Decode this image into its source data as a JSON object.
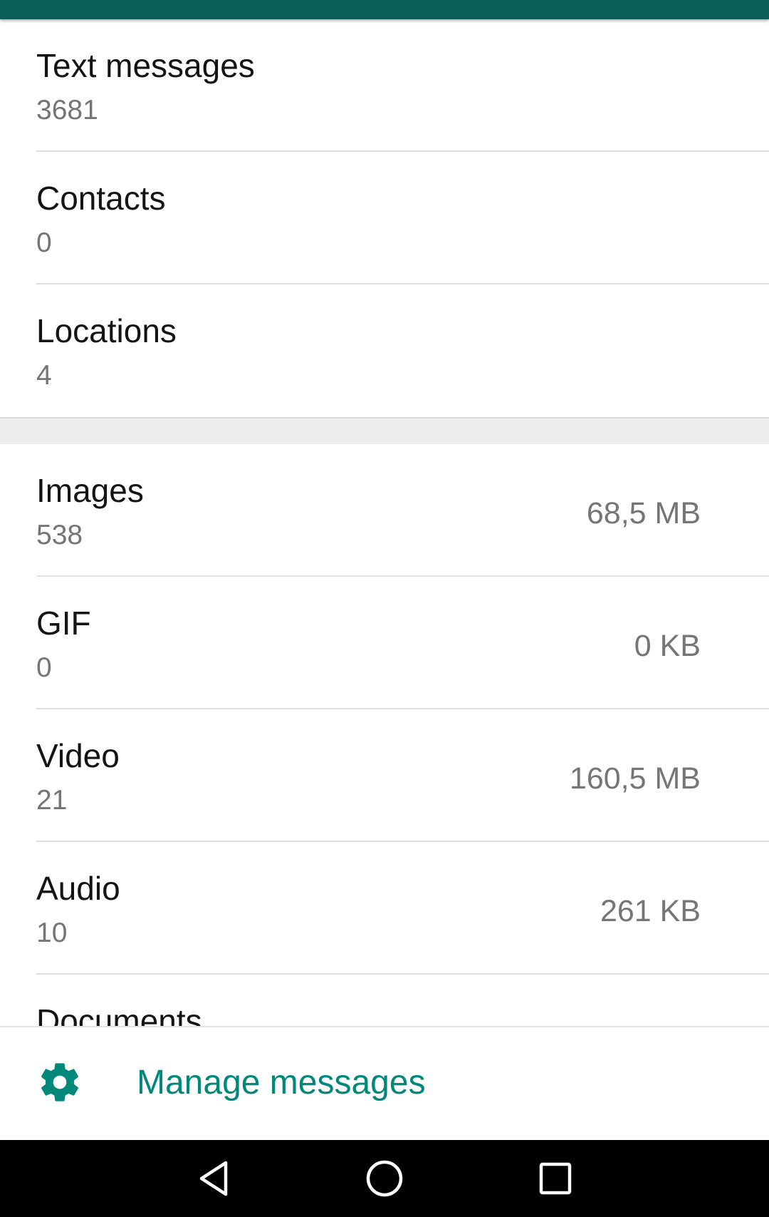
{
  "theme": {
    "appbar_color": "#0b5e55",
    "accent": "#00897b"
  },
  "messages_section": {
    "items": [
      {
        "label": "Text messages",
        "count": "3681"
      },
      {
        "label": "Contacts",
        "count": "0"
      },
      {
        "label": "Locations",
        "count": "4"
      }
    ]
  },
  "media_section": {
    "items": [
      {
        "label": "Images",
        "count": "538",
        "size": "68,5 MB"
      },
      {
        "label": "GIF",
        "count": "0",
        "size": "0 KB"
      },
      {
        "label": "Video",
        "count": "21",
        "size": "160,5 MB"
      },
      {
        "label": "Audio",
        "count": "10",
        "size": "261 KB"
      },
      {
        "label": "Documents",
        "count": "",
        "size": ""
      }
    ]
  },
  "footer": {
    "icon": "gear-icon",
    "label": "Manage messages"
  },
  "navbar": {
    "buttons": [
      "back-icon",
      "home-icon",
      "recents-icon"
    ]
  }
}
